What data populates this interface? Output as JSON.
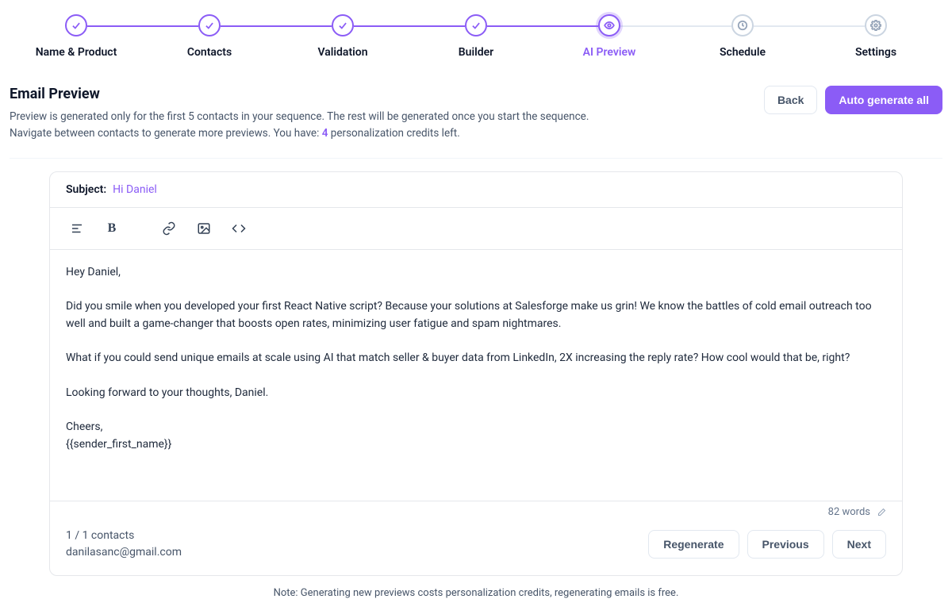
{
  "stepper": [
    {
      "label": "Name & Product",
      "state": "done"
    },
    {
      "label": "Contacts",
      "state": "done"
    },
    {
      "label": "Validation",
      "state": "done"
    },
    {
      "label": "Builder",
      "state": "done"
    },
    {
      "label": "AI Preview",
      "state": "active"
    },
    {
      "label": "Schedule",
      "state": "inactive"
    },
    {
      "label": "Settings",
      "state": "inactive"
    }
  ],
  "header": {
    "title": "Email Preview",
    "desc_line1": "Preview is generated only for the first 5 contacts in your sequence. The rest will be generated once you start the sequence.",
    "desc_line2_prefix": "Navigate between contacts to generate more previews. You have: ",
    "credits": "4",
    "desc_line2_suffix": " personalization credits left.",
    "back_label": "Back",
    "auto_generate_label": "Auto generate all"
  },
  "editor": {
    "subject_label": "Subject:",
    "subject_value": "Hi Daniel",
    "body": "Hey Daniel,\n\nDid you smile when you developed your first React Native script? Because your solutions at Salesforge make us grin! We know the battles of cold email outreach too well and built a game-changer that boosts open rates, minimizing user fatigue and spam nightmares.\n\nWhat if you could send unique emails at scale using AI that match seller & buyer data from LinkedIn, 2X increasing the reply rate? How cool would that be, right?\n\nLooking forward to your thoughts, Daniel.\n\nCheers,\n{{sender_first_name}}",
    "word_count": "82 words"
  },
  "footer": {
    "contact_count": "1 / 1 contacts",
    "contact_email": "danilasanc@gmail.com",
    "regenerate_label": "Regenerate",
    "previous_label": "Previous",
    "next_label": "Next"
  },
  "note": "Note: Generating new previews costs personalization credits, regenerating emails is free."
}
